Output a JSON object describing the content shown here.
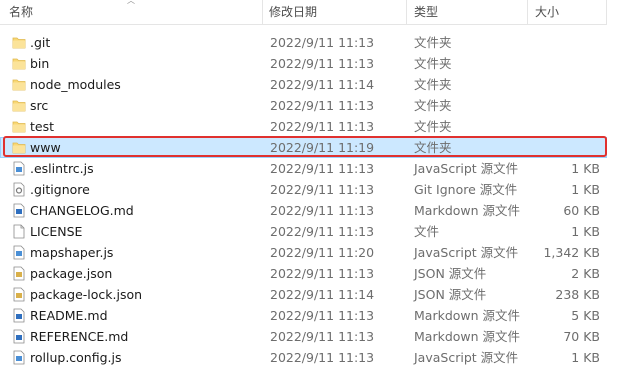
{
  "columns": {
    "name": "名称",
    "date": "修改日期",
    "type": "类型",
    "size": "大小"
  },
  "files": [
    {
      "name": ".git",
      "date": "2022/9/11 11:13",
      "type": "文件夹",
      "size": "",
      "icon": "folder-icon"
    },
    {
      "name": "bin",
      "date": "2022/9/11 11:13",
      "type": "文件夹",
      "size": "",
      "icon": "folder-icon"
    },
    {
      "name": "node_modules",
      "date": "2022/9/11 11:14",
      "type": "文件夹",
      "size": "",
      "icon": "folder-icon"
    },
    {
      "name": "src",
      "date": "2022/9/11 11:13",
      "type": "文件夹",
      "size": "",
      "icon": "folder-icon"
    },
    {
      "name": "test",
      "date": "2022/9/11 11:13",
      "type": "文件夹",
      "size": "",
      "icon": "folder-icon"
    },
    {
      "name": "www",
      "date": "2022/9/11 11:19",
      "type": "文件夹",
      "size": "",
      "icon": "folder-icon",
      "selected": true,
      "highlighted": true
    },
    {
      "name": ".eslintrc.js",
      "date": "2022/9/11 11:13",
      "type": "JavaScript 源文件",
      "size": "1 KB",
      "icon": "js-file-icon"
    },
    {
      "name": ".gitignore",
      "date": "2022/9/11 11:13",
      "type": "Git Ignore 源文件",
      "size": "1 KB",
      "icon": "config-file-icon"
    },
    {
      "name": "CHANGELOG.md",
      "date": "2022/9/11 11:13",
      "type": "Markdown 源文件",
      "size": "60 KB",
      "icon": "markdown-file-icon"
    },
    {
      "name": "LICENSE",
      "date": "2022/9/11 11:13",
      "type": "文件",
      "size": "1 KB",
      "icon": "blank-file-icon"
    },
    {
      "name": "mapshaper.js",
      "date": "2022/9/11 11:20",
      "type": "JavaScript 源文件",
      "size": "1,342 KB",
      "icon": "js-file-icon"
    },
    {
      "name": "package.json",
      "date": "2022/9/11 11:13",
      "type": "JSON 源文件",
      "size": "2 KB",
      "icon": "json-file-icon"
    },
    {
      "name": "package-lock.json",
      "date": "2022/9/11 11:14",
      "type": "JSON 源文件",
      "size": "238 KB",
      "icon": "json-file-icon"
    },
    {
      "name": "README.md",
      "date": "2022/9/11 11:13",
      "type": "Markdown 源文件",
      "size": "5 KB",
      "icon": "markdown-file-icon"
    },
    {
      "name": "REFERENCE.md",
      "date": "2022/9/11 11:13",
      "type": "Markdown 源文件",
      "size": "70 KB",
      "icon": "markdown-file-icon"
    },
    {
      "name": "rollup.config.js",
      "date": "2022/9/11 11:13",
      "type": "JavaScript 源文件",
      "size": "1 KB",
      "icon": "js-file-icon"
    }
  ],
  "colors": {
    "folder": "#f8d775",
    "selection": "#cce8ff",
    "highlight_border": "#e0312f"
  }
}
